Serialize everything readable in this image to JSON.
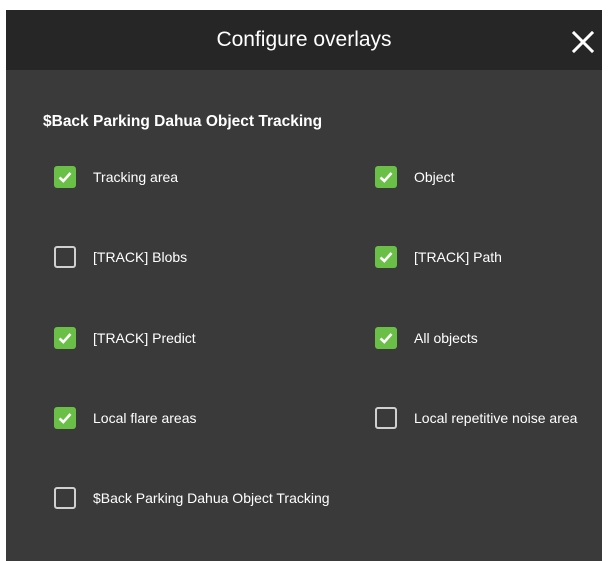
{
  "dialog": {
    "title": "Configure overlays",
    "close_icon": "close-icon"
  },
  "section": {
    "title": "$Back Parking Dahua Object Tracking"
  },
  "options": [
    {
      "label": "Tracking area",
      "checked": true
    },
    {
      "label": "Object",
      "checked": true
    },
    {
      "label": "[TRACK] Blobs",
      "checked": false
    },
    {
      "label": "[TRACK] Path",
      "checked": true
    },
    {
      "label": "[TRACK] Predict",
      "checked": true
    },
    {
      "label": "All objects",
      "checked": true
    },
    {
      "label": "Local flare areas",
      "checked": true
    },
    {
      "label": "Local repetitive noise area",
      "checked": false
    },
    {
      "label": "$Back Parking Dahua Object Tracking",
      "checked": false
    }
  ],
  "colors": {
    "checkbox_checked": "#6abf46",
    "checkbox_unchecked_border": "#d0d0d0",
    "dialog_bg": "#3a3a3a",
    "header_bg": "#262626"
  }
}
